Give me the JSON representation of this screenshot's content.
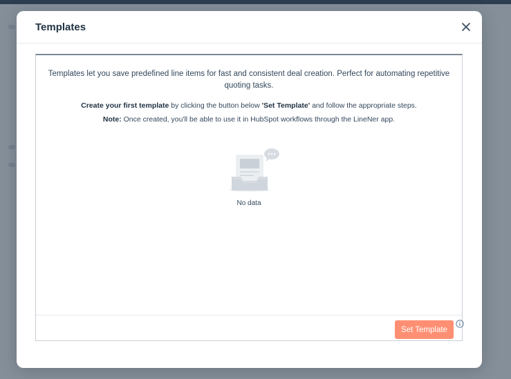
{
  "modal": {
    "title": "Templates",
    "close_icon": "close-icon"
  },
  "content": {
    "intro": "Templates let you save predefined line items for fast and consistent deal creation. Perfect for automating repetitive quoting tasks.",
    "step_bold": "Create your first template",
    "step_middle": " by clicking the button below ",
    "step_quote": "'Set Template'",
    "step_end": " and follow the appropriate steps.",
    "note_label": "Note:",
    "note_text": " Once created, you'll be able to use it in HubSpot workflows through the LineNer app.",
    "empty_icon": "empty-inbox-icon",
    "empty_text": "No data"
  },
  "footer": {
    "set_template_label": "Set Template",
    "info_icon": "info-icon"
  },
  "colors": {
    "primary_button": "#ff8f73",
    "text": "#33475b",
    "title": "#213343"
  }
}
